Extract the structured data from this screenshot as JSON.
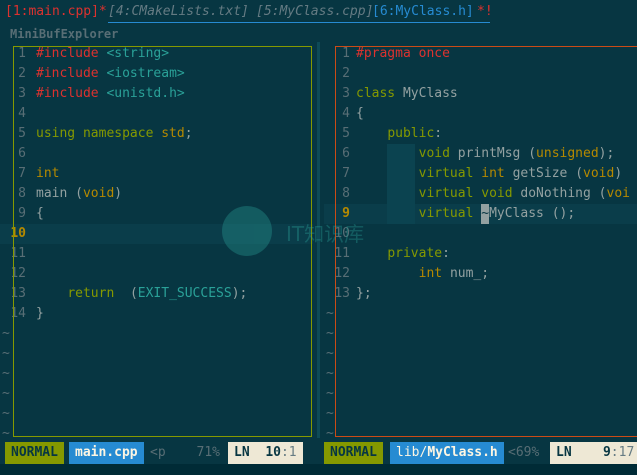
{
  "tabs": [
    {
      "label": "[1:main.cpp]*",
      "state": "active"
    },
    {
      "label": "[4:CMakeLists.txt]",
      "state": "hidden"
    },
    {
      "label": "[5:MyClass.cpp]",
      "state": "hidden"
    },
    {
      "label": "[6:MyClass.h]",
      "state": "current"
    },
    {
      "label": "*!",
      "state": "modified"
    }
  ],
  "minibuf_title": "MiniBufExplorer",
  "left": {
    "lines": [
      {
        "n": "1",
        "parts": [
          [
            "pre",
            "#include "
          ],
          [
            "str",
            "<string>"
          ]
        ]
      },
      {
        "n": "2",
        "parts": [
          [
            "pre",
            "#include "
          ],
          [
            "str",
            "<iostream>"
          ]
        ]
      },
      {
        "n": "3",
        "parts": [
          [
            "pre",
            "#include "
          ],
          [
            "str",
            "<unistd.h>"
          ]
        ]
      },
      {
        "n": "4",
        "parts": []
      },
      {
        "n": "5",
        "parts": [
          [
            "kw",
            "using namespace "
          ],
          [
            "type",
            "std"
          ],
          [
            "id",
            ";"
          ]
        ]
      },
      {
        "n": "6",
        "parts": []
      },
      {
        "n": "7",
        "parts": [
          [
            "type",
            "int"
          ]
        ]
      },
      {
        "n": "8",
        "parts": [
          [
            "id",
            "main "
          ],
          [
            "paren",
            "("
          ],
          [
            "type",
            "void"
          ],
          [
            "paren",
            ")"
          ]
        ]
      },
      {
        "n": "9",
        "parts": [
          [
            "id",
            "{"
          ]
        ]
      },
      {
        "n": "10",
        "parts": [],
        "current": true
      },
      {
        "n": "11",
        "parts": []
      },
      {
        "n": "12",
        "parts": []
      },
      {
        "n": "13",
        "parts": [
          [
            "id",
            "    "
          ],
          [
            "kw",
            "return"
          ],
          [
            "id",
            "  "
          ],
          [
            "paren",
            "("
          ],
          [
            "num",
            "EXIT_SUCCESS"
          ],
          [
            "paren",
            ")"
          ],
          [
            "id",
            ";"
          ]
        ]
      },
      {
        "n": "14",
        "parts": [
          [
            "id",
            "}"
          ]
        ]
      }
    ],
    "tilde_count": 6,
    "status": {
      "mode": "NORMAL",
      "file": "main.cpp",
      "extra": "<p",
      "pct": "71%",
      "ln_label": "LN",
      "line": "10",
      "col": ":1"
    }
  },
  "right": {
    "lines": [
      {
        "n": "1",
        "parts": [
          [
            "pre",
            "#pragma once"
          ]
        ]
      },
      {
        "n": "2",
        "parts": []
      },
      {
        "n": "3",
        "parts": [
          [
            "kw",
            "class "
          ],
          [
            "id",
            "MyClass"
          ]
        ]
      },
      {
        "n": "4",
        "parts": [
          [
            "id",
            "{"
          ]
        ]
      },
      {
        "n": "5",
        "parts": [
          [
            "id",
            "    "
          ],
          [
            "kw",
            "public"
          ],
          [
            "id",
            ":"
          ]
        ]
      },
      {
        "n": "6",
        "parts": [
          [
            "id",
            "        "
          ],
          [
            "kw",
            "void "
          ],
          [
            "id",
            "printMsg "
          ],
          [
            "paren",
            "("
          ],
          [
            "type",
            "unsigned"
          ],
          [
            "paren",
            ")"
          ],
          [
            "id",
            ";"
          ]
        ]
      },
      {
        "n": "7",
        "parts": [
          [
            "id",
            "        "
          ],
          [
            "kw",
            "virtual "
          ],
          [
            "type",
            "int "
          ],
          [
            "id",
            "getSize "
          ],
          [
            "paren",
            "("
          ],
          [
            "type",
            "void"
          ],
          [
            "paren",
            ")"
          ]
        ]
      },
      {
        "n": "8",
        "parts": [
          [
            "id",
            "        "
          ],
          [
            "kw",
            "virtual "
          ],
          [
            "kw",
            "void "
          ],
          [
            "id",
            "doNothing "
          ],
          [
            "paren",
            "("
          ],
          [
            "type",
            "voi"
          ]
        ]
      },
      {
        "n": "9",
        "parts": [
          [
            "id",
            "        "
          ],
          [
            "kw",
            "virtual "
          ],
          [
            "cursor",
            "~"
          ],
          [
            "id",
            "MyClass "
          ],
          [
            "paren",
            "()"
          ],
          [
            "id",
            ";"
          ]
        ],
        "current": true
      },
      {
        "n": "10",
        "parts": []
      },
      {
        "n": "11",
        "parts": [
          [
            "id",
            "    "
          ],
          [
            "kw",
            "private"
          ],
          [
            "id",
            ":"
          ]
        ]
      },
      {
        "n": "12",
        "parts": [
          [
            "id",
            "        "
          ],
          [
            "type",
            "int "
          ],
          [
            "id",
            "num_;"
          ]
        ]
      },
      {
        "n": "13",
        "parts": [
          [
            "id",
            "};"
          ]
        ]
      }
    ],
    "tilde_count": 7,
    "status": {
      "mode": "NORMAL",
      "file_dir": "lib/",
      "file_name": "MyClass.h",
      "extra": "<69%",
      "ln_label": "LN",
      "line": "9",
      "col": ":17"
    }
  },
  "watermark_text": "IT知识库",
  "colors": {
    "bg": "#073642",
    "green": "#859900",
    "blue": "#268bd2",
    "red": "#dc322f",
    "orange": "#cb4b16",
    "yellow": "#b58900",
    "cyan": "#2aa198"
  }
}
